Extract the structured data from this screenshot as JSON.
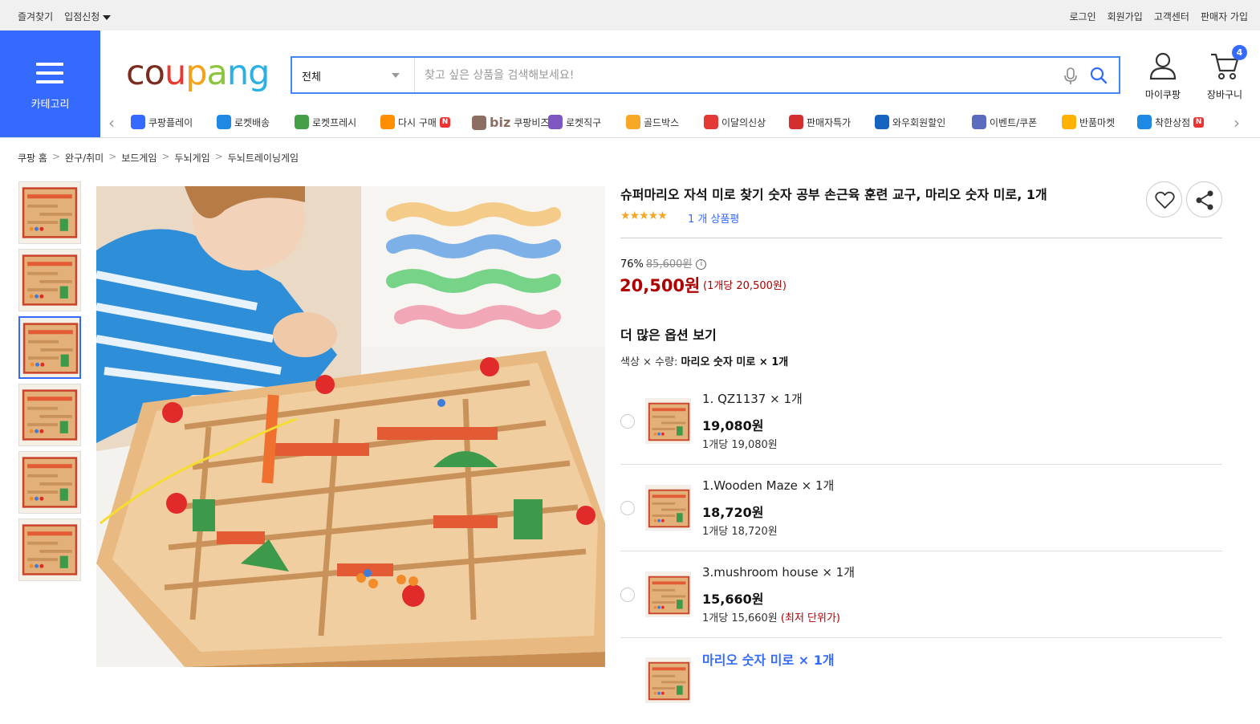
{
  "topbar": {
    "bookmark": "즐겨찾기",
    "seller_apply": "입점신청",
    "login": "로그인",
    "signup": "회원가입",
    "support": "고객센터",
    "seller_join": "판매자 가입"
  },
  "header": {
    "category_label": "카테고리",
    "logo": "coupang",
    "search_scope": "전체",
    "search_placeholder": "찾고 싶은 상품을 검색해보세요!",
    "mycoupang": "마이쿠팡",
    "cart": "장바구니",
    "cart_count": "4"
  },
  "quick_menu": [
    {
      "label": "쿠팡플레이",
      "color": "#346aff"
    },
    {
      "label": "로켓배송",
      "color": "#1e88e5"
    },
    {
      "label": "로켓프레시",
      "color": "#43a047"
    },
    {
      "label": "다시 구매",
      "color": "#ff8f00",
      "badge": "N"
    },
    {
      "label": "쿠팡비즈",
      "prefix": "biz",
      "color": "#8d6e63"
    },
    {
      "label": "로켓직구",
      "color": "#7e57c2"
    },
    {
      "label": "골드박스",
      "color": "#f9a825"
    },
    {
      "label": "이달의신상",
      "color": "#e53935"
    },
    {
      "label": "판매자특가",
      "color": "#d32f2f"
    },
    {
      "label": "와우회원할인",
      "color": "#1565c0"
    },
    {
      "label": "이벤트/쿠폰",
      "color": "#5c6bc0"
    },
    {
      "label": "반품마켓",
      "color": "#ffb300"
    },
    {
      "label": "착한상점",
      "color": "#1e88e5",
      "badge": "N"
    }
  ],
  "breadcrumb": [
    "쿠팡 홈",
    "완구/취미",
    "보드게임",
    "두뇌게임",
    "두뇌트레이닝게임"
  ],
  "product": {
    "title": "슈퍼마리오 자석 미로 찾기 숫자 공부 손근육 훈련 교구, 마리오 숫자 미로, 1개",
    "stars": "★★★★★",
    "rating": 5,
    "review_text": "1 개 상품평",
    "discount": "76%",
    "original_price": "85,600원",
    "price": "20,500원",
    "unit_price": "(1개당 20,500원)"
  },
  "options": {
    "heading": "더 많은 옵션 보기",
    "selection_label": "색상 × 수량:",
    "selection_value": "마리오 숫자 미로 × 1개",
    "items": [
      {
        "name": "1. QZ1137 × 1개",
        "price": "19,080원",
        "unit": "1개당 19,080원",
        "note": ""
      },
      {
        "name": "1.Wooden Maze × 1개",
        "price": "18,720원",
        "unit": "1개당 18,720원",
        "note": ""
      },
      {
        "name": "3.mushroom house × 1개",
        "price": "15,660원",
        "unit": "1개당 15,660원",
        "note": "(최저 단위가)"
      },
      {
        "name": "마리오 숫자 미로 × 1개",
        "price": "",
        "unit": "",
        "note": ""
      }
    ]
  },
  "colors": {
    "accent": "#346aff",
    "price_red": "#ae0000",
    "star": "#f5a623"
  }
}
